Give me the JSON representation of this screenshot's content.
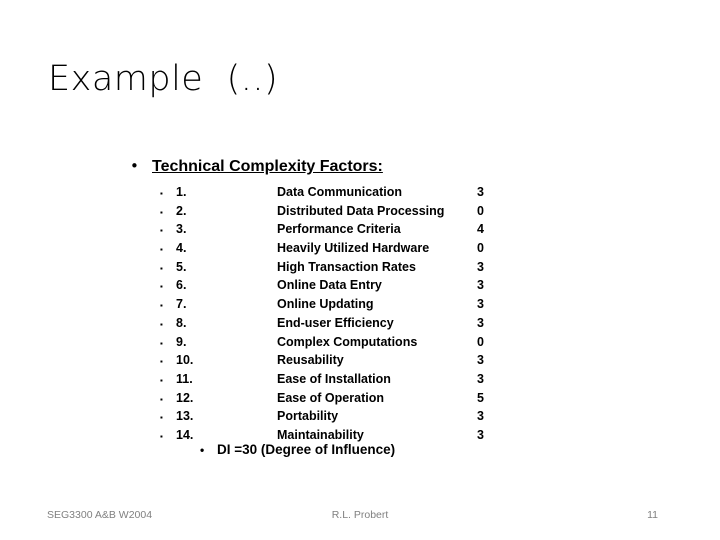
{
  "slide": {
    "title": "Example  (..)",
    "background_color": "#ffffff",
    "text_color": "#000000"
  },
  "header": {
    "bullet": "•",
    "label": "Technical Complexity Factors:"
  },
  "factors": {
    "bullet": "▪",
    "columns": [
      "index",
      "name",
      "value"
    ],
    "rows": [
      {
        "index": "1.",
        "name": "Data Communication",
        "value": "3"
      },
      {
        "index": "2.",
        "name": "Distributed Data Processing",
        "value": "0"
      },
      {
        "index": "3.",
        "name": "Performance Criteria",
        "value": "4"
      },
      {
        "index": "4.",
        "name": "Heavily Utilized Hardware",
        "value": "0"
      },
      {
        "index": "5.",
        "name": "High Transaction Rates",
        "value": "3"
      },
      {
        "index": "6.",
        "name": "Online Data Entry",
        "value": "3"
      },
      {
        "index": "7.",
        "name": "Online Updating",
        "value": "3"
      },
      {
        "index": "8.",
        "name": "End-user Efficiency",
        "value": "3"
      },
      {
        "index": "9.",
        "name": "Complex Computations",
        "value": "0"
      },
      {
        "index": "10.",
        "name": "Reusability",
        "value": "3"
      },
      {
        "index": "11.",
        "name": "Ease of Installation",
        "value": "3"
      },
      {
        "index": "12.",
        "name": "Ease of Operation",
        "value": "5"
      },
      {
        "index": "13.",
        "name": "Portability",
        "value": "3"
      },
      {
        "index": "14.",
        "name": "Maintainability",
        "value": "3"
      }
    ]
  },
  "summary": {
    "bullet": "•",
    "text": "DI =30 (Degree of Influence)"
  },
  "footer": {
    "left": "SEG3300 A&B W2004",
    "center": "R.L. Probert",
    "page_number": "11",
    "color": "#808080"
  }
}
